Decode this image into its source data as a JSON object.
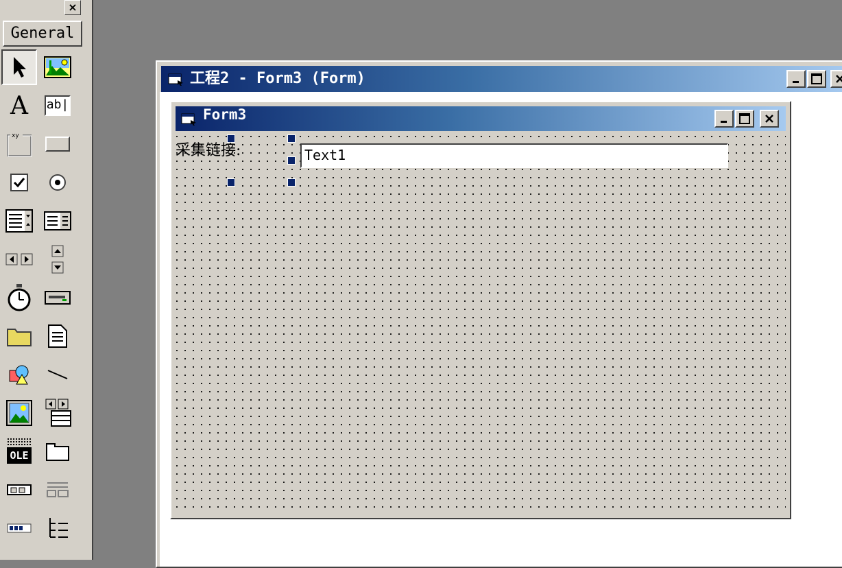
{
  "toolbox": {
    "close_label": "×",
    "tab_label": "General",
    "tools": [
      {
        "name": "pointer-icon"
      },
      {
        "name": "picturebox-icon"
      },
      {
        "name": "label-icon",
        "glyph": "A"
      },
      {
        "name": "textbox-icon",
        "glyph": "ab|"
      },
      {
        "name": "frame-icon"
      },
      {
        "name": "commandbutton-icon"
      },
      {
        "name": "checkbox-icon"
      },
      {
        "name": "optionbutton-icon"
      },
      {
        "name": "combobox-icon"
      },
      {
        "name": "listbox-icon"
      },
      {
        "name": "hscrollbar-icon"
      },
      {
        "name": "vscrollbar-icon"
      },
      {
        "name": "timer-icon"
      },
      {
        "name": "drivelistbox-icon"
      },
      {
        "name": "dirlistbox-icon"
      },
      {
        "name": "filelistbox-icon"
      },
      {
        "name": "shape-icon"
      },
      {
        "name": "line-icon"
      },
      {
        "name": "image-icon"
      },
      {
        "name": "data-icon"
      },
      {
        "name": "ole-icon",
        "glyph": "OLE"
      },
      {
        "name": "tabstrip-icon"
      },
      {
        "name": "toolbar-icon"
      },
      {
        "name": "statusbar-icon"
      },
      {
        "name": "progressbar-icon"
      },
      {
        "name": "treeview-icon"
      }
    ]
  },
  "project_window": {
    "title": "工程2 - Form3 (Form)"
  },
  "form": {
    "title": "Form3",
    "label_caption": "采集链接:",
    "textbox_text": "Text1"
  },
  "colors": {
    "titlebar_start": "#0a246a",
    "titlebar_end": "#a6caf0",
    "face": "#d4d0c8",
    "desktop": "#808080"
  }
}
